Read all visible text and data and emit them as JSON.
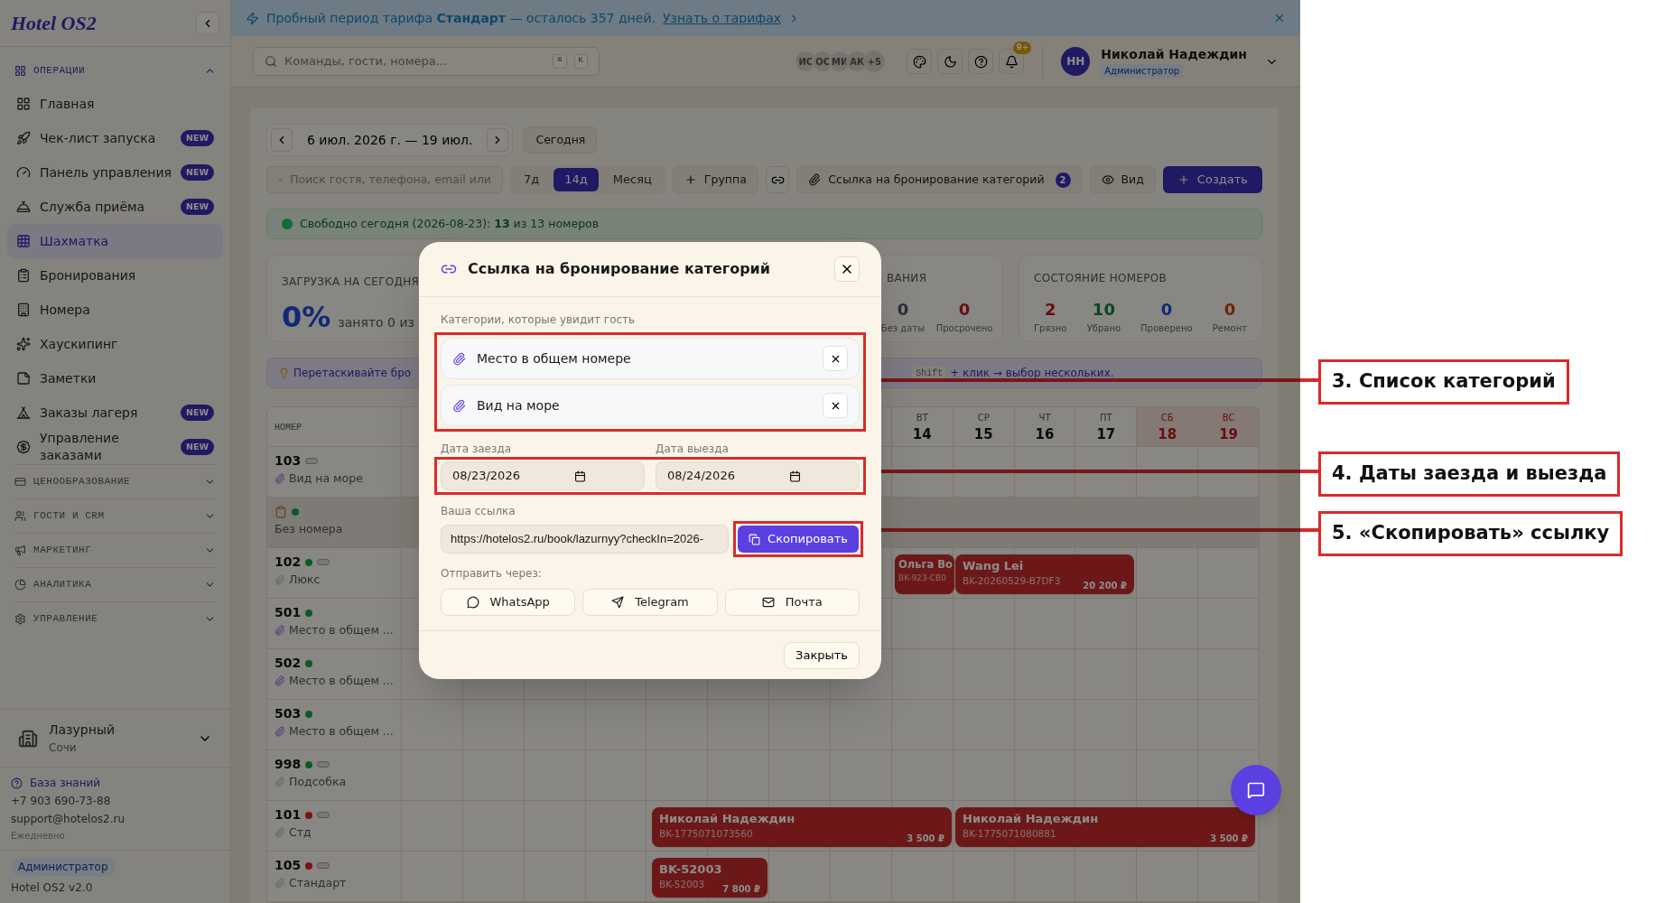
{
  "sidebar": {
    "logo": "Hotel OS2",
    "groups": [
      {
        "label": "ОПЕРАЦИИ",
        "expanded": true,
        "items": [
          {
            "label": "Главная",
            "selected": false
          },
          {
            "label": "Чек-лист запуска",
            "badge": "NEW",
            "selected": false
          },
          {
            "label": "Панель управления",
            "badge": "NEW",
            "selected": false
          },
          {
            "label": "Служба приёма",
            "badge": "NEW",
            "selected": false
          },
          {
            "label": "Шахматка",
            "selected": true
          },
          {
            "label": "Бронирования",
            "selected": false
          },
          {
            "label": "Номера",
            "selected": false
          },
          {
            "label": "Хаускипинг",
            "selected": false
          },
          {
            "label": "Заметки",
            "selected": false
          },
          {
            "label": "Заказы лагеря",
            "badge": "NEW",
            "selected": false
          },
          {
            "label": "Управление заказами",
            "badge": "NEW",
            "selected": false
          }
        ]
      },
      {
        "label": "ЦЕНООБРАЗОВАНИЕ",
        "expanded": false
      },
      {
        "label": "ГОСТИ И CRM",
        "expanded": false
      },
      {
        "label": "МАРКЕТИНГ",
        "expanded": false
      },
      {
        "label": "АНАЛИТИКА",
        "expanded": false
      },
      {
        "label": "УПРАВЛЕНИЕ",
        "expanded": false
      }
    ],
    "property": {
      "name": "Лазурный",
      "city": "Сочи"
    },
    "help": {
      "link": "База знаний",
      "phone": "+7 903 690-73-88",
      "email": "support@hotelos2.ru",
      "hours": "Ежедневно"
    },
    "role": "Администратор",
    "version": "Hotel OS2 v2.0"
  },
  "banner": {
    "text": "Пробный период тарифа **Стандарт** — осталось 357 дней.",
    "link": "Узнать о тарифах"
  },
  "header": {
    "search_placeholder": "Команды, гости, номера...",
    "shortcut": [
      "⌘",
      "K"
    ],
    "avatars": [
      "ИС",
      "ОС",
      "МИ",
      "АК"
    ],
    "more": "+5",
    "notifications": "9+",
    "user": {
      "initials": "НН",
      "name": "Николай Надеждин",
      "role": "Администратор"
    }
  },
  "toolbar": {
    "range": "6 июл. 2026 г. — 19 июл.",
    "today": "Сегодня",
    "search_placeholder": "Поиск гостя, телефона, email или",
    "periods": [
      {
        "label": "7д",
        "selected": false
      },
      {
        "label": "14д",
        "selected": true
      },
      {
        "label": "Месяц",
        "selected": false
      }
    ],
    "group": "Группа",
    "category_link": "Ссылка на бронирование категорий",
    "category_count": "2",
    "view": "Вид",
    "create": "Создать"
  },
  "notice": "Свободно сегодня (2026-08-23): **13** из 13 номеров",
  "occupancy": {
    "title": "ЗАГРУЗКА НА СЕГОДНЯ",
    "value": "0%",
    "caption": "занято 0 из"
  },
  "bookings_card": {
    "title": "ВАНИЯ",
    "stats": [
      {
        "value": "0",
        "label": "Без даты",
        "color": "#272f3a"
      },
      {
        "value": "0",
        "label": "Просрочено",
        "color": "#660f0f"
      }
    ]
  },
  "rooms_card": {
    "title": "СОСТОЯНИЕ НОМЕРОВ",
    "stats": [
      {
        "value": "2",
        "label": "Грязно",
        "color": "#660f0f"
      },
      {
        "value": "10",
        "label": "Убрано",
        "color": "#0c4622"
      },
      {
        "value": "0",
        "label": "Проверено",
        "color": "#102b77"
      },
      {
        "value": "0",
        "label": "Ремонт",
        "color": "#6b2407"
      }
    ]
  },
  "hint": {
    "left": "Перетаскивайте бро",
    "key": "Shift",
    "right": "+ клик → выбор нескольких."
  },
  "grid": {
    "room_header": "НОМЕР",
    "days": [
      {
        "weekday": "ВТ",
        "day": "14",
        "weekend": false
      },
      {
        "weekday": "СР",
        "day": "15",
        "weekend": false
      },
      {
        "weekday": "ЧТ",
        "day": "16",
        "weekend": false
      },
      {
        "weekday": "ПТ",
        "day": "17",
        "weekend": false
      },
      {
        "weekday": "СБ",
        "day": "18",
        "weekend": true
      },
      {
        "weekday": "ВС",
        "day": "19",
        "weekend": true
      }
    ],
    "rows": [
      {
        "kind": "room",
        "number": "103",
        "category": "Вид на море",
        "pill": true,
        "highlighted": true
      },
      {
        "kind": "unassigned",
        "category": "Без номера",
        "color": "#0c5a29",
        "pill": false
      },
      {
        "kind": "room",
        "number": "102",
        "category": "Люкс",
        "color": "#0c5a29",
        "pill": true,
        "highlighted": false,
        "bookings": [
          {
            "guest": "Ольга Во",
            "code": "BK-923-CB0"
          },
          {
            "guest": "Wang Lei",
            "code": "BK-20260529-B7DF3",
            "price": "20 200 ₽"
          }
        ]
      },
      {
        "kind": "room",
        "number": "501",
        "category": "Место в общем ...",
        "color": "#0c5a29",
        "pill": false,
        "highlighted": true
      },
      {
        "kind": "room",
        "number": "502",
        "category": "Место в общем ...",
        "color": "#0c5a29",
        "pill": false,
        "highlighted": true
      },
      {
        "kind": "room",
        "number": "503",
        "category": "Место в общем ...",
        "color": "#0c5a29",
        "pill": false,
        "highlighted": true
      },
      {
        "kind": "room",
        "number": "998",
        "category": "Подсобка",
        "color": "#0c5a29",
        "pill": true,
        "highlighted": false
      },
      {
        "kind": "room",
        "number": "101",
        "category": "Стд",
        "color": "#791515",
        "pill": true,
        "highlighted": false,
        "bookings": [
          {
            "guest": "Николай Надеждин",
            "code": "BK-1775071073560",
            "price": "3 500 ₽"
          },
          {
            "guest": "Николай Надеждин",
            "code": "BK-1775071080881",
            "price": "3 500 ₽"
          }
        ]
      },
      {
        "kind": "room",
        "number": "105",
        "category": "Стандарт",
        "color": "#791515",
        "pill": true,
        "highlighted": false,
        "bookings": [
          {
            "guest": "BK-52003",
            "code": "BK-52003",
            "price": "7 800 ₽"
          }
        ]
      }
    ]
  },
  "modal": {
    "title": "Ссылка на бронирование категорий",
    "categories_label": "Категории, которые увидит гость",
    "categories": [
      "Место в общем номере",
      "Вид на море"
    ],
    "checkin_label": "Дата заезда",
    "checkin": "08/23/2026",
    "checkout_label": "Дата выезда",
    "checkout": "08/24/2026",
    "link_label": "Ваша ссылка",
    "link": "https://hotelos2.ru/book/lazurnyy?checkIn=2026-",
    "copy": "Скопировать",
    "send_label": "Отправить через:",
    "channels": [
      "WhatsApp",
      "Telegram",
      "Почта"
    ],
    "close": "Закрыть"
  },
  "callouts": [
    "3. Список категорий",
    "4. Даты заезда и выезда",
    "5. «Скопировать» ссылку"
  ]
}
